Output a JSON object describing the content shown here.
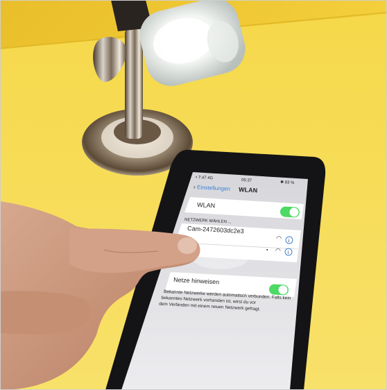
{
  "status_bar": {
    "carrier": "• 7:47 4G",
    "time": "05:37",
    "battery": "✱ 83 %"
  },
  "nav": {
    "back_label": "Einstellungen",
    "title": "WLAN"
  },
  "wlan": {
    "label": "WLAN",
    "enabled": true
  },
  "section_header": "NETZWERK WÄHLEN ...",
  "networks": [
    {
      "name": "Cam-2472603dc2e3",
      "locked": false,
      "info_icon": "info-icon",
      "wifi_icon": "wifi-icon"
    },
    {
      "name": "",
      "locked": true,
      "info_icon": "info-icon",
      "wifi_icon": "wifi-icon"
    }
  ],
  "ask_to_join": {
    "label": "Netze hinweisen",
    "enabled": true,
    "description": "Bekannte Netzwerke werden automatisch verbunden. Falls kein bekanntes Netzwerk vorhanden ist, wirst du vor dem Verbinden mit einem neuen Netzwerk gefragt."
  },
  "colors": {
    "ios_blue": "#3b82d6",
    "toggle_green": "#4cd964",
    "background_yellow": "#f5d23a"
  }
}
